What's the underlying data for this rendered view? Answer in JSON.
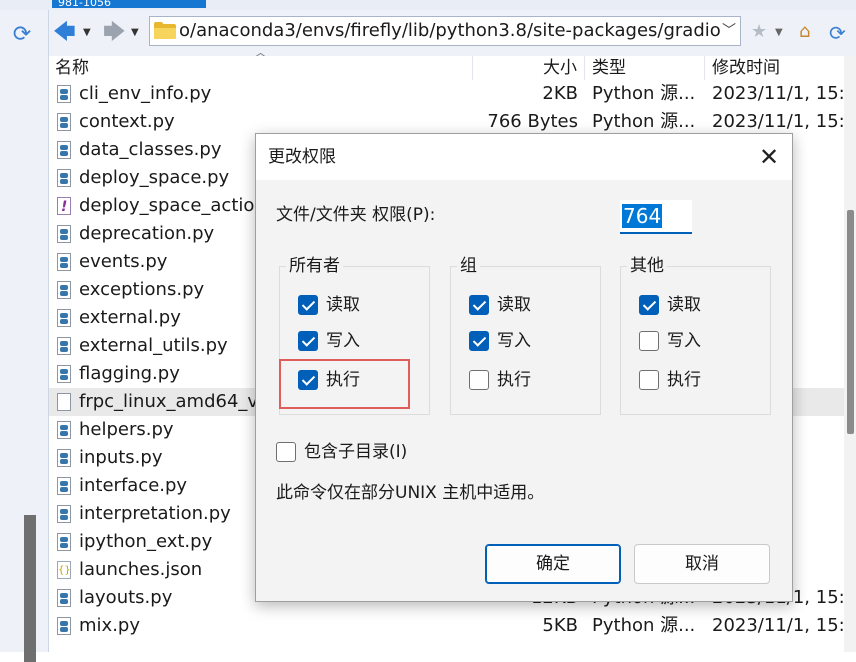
{
  "window": {
    "tab_title": "981-1056"
  },
  "address_bar": {
    "path": "o/anaconda3/envs/firefly/lib/python3.8/site-packages/gradio"
  },
  "columns": {
    "name": "名称",
    "size": "大小",
    "type": "类型",
    "modified": "修改时间"
  },
  "files": [
    {
      "name": "cli_env_info.py",
      "size": "2KB",
      "type": "Python 源...",
      "modified": "2023/11/1, 15:",
      "icon": "python-file-icon"
    },
    {
      "name": "context.py",
      "size": "766 Bytes",
      "type": "Python 源...",
      "modified": "2023/11/1, 15:",
      "icon": "python-file-icon"
    },
    {
      "name": "data_classes.py",
      "size": "",
      "type": "",
      "modified": "1, 15:",
      "icon": "python-file-icon"
    },
    {
      "name": "deploy_space.py",
      "size": "",
      "type": "",
      "modified": "1, 15:",
      "icon": "python-file-icon"
    },
    {
      "name": "deploy_space_action",
      "size": "",
      "type": "",
      "modified": "1, 15:",
      "icon": "unknown-file-icon"
    },
    {
      "name": "deprecation.py",
      "size": "",
      "type": "",
      "modified": "1, 15:",
      "icon": "python-file-icon"
    },
    {
      "name": "events.py",
      "size": "",
      "type": "",
      "modified": "1, 15:",
      "icon": "python-file-icon"
    },
    {
      "name": "exceptions.py",
      "size": "",
      "type": "",
      "modified": "1, 15:",
      "icon": "python-file-icon"
    },
    {
      "name": "external.py",
      "size": "",
      "type": "",
      "modified": "1, 15:",
      "icon": "python-file-icon"
    },
    {
      "name": "external_utils.py",
      "size": "",
      "type": "",
      "modified": "1, 15:",
      "icon": "python-file-icon"
    },
    {
      "name": "flagging.py",
      "size": "",
      "type": "",
      "modified": "1, 15:",
      "icon": "python-file-icon"
    },
    {
      "name": "frpc_linux_amd64_v0",
      "size": "",
      "type": "",
      "modified": "1, 16:",
      "icon": "generic-file-icon"
    },
    {
      "name": "helpers.py",
      "size": "",
      "type": "",
      "modified": "1, 15:",
      "icon": "python-file-icon"
    },
    {
      "name": "inputs.py",
      "size": "",
      "type": "",
      "modified": "1, 15:",
      "icon": "python-file-icon"
    },
    {
      "name": "interface.py",
      "size": "",
      "type": "",
      "modified": "1, 15:",
      "icon": "python-file-icon"
    },
    {
      "name": "interpretation.py",
      "size": "",
      "type": "",
      "modified": "1, 15:",
      "icon": "python-file-icon"
    },
    {
      "name": "ipython_ext.py",
      "size": "",
      "type": "",
      "modified": "1, 15:",
      "icon": "python-file-icon"
    },
    {
      "name": "launches.json",
      "size": "",
      "type": "",
      "modified": "1, 20:",
      "icon": "json-file-icon"
    },
    {
      "name": "layouts.py",
      "size": "12KB",
      "type": "Python 源...",
      "modified": "2023/11/1, 15:",
      "icon": "python-file-icon"
    },
    {
      "name": "mix.py",
      "size": "5KB",
      "type": "Python 源...",
      "modified": "2023/11/1, 15:",
      "icon": "python-file-icon"
    }
  ],
  "selected_file_index": 11,
  "dialog": {
    "title": "更改权限",
    "permission_label": "文件/文件夹 权限(P):",
    "permission_value": "764",
    "groups": [
      {
        "name": "所有者",
        "read": {
          "label": "读取",
          "checked": true
        },
        "write": {
          "label": "写入",
          "checked": true
        },
        "exec": {
          "label": "执行",
          "checked": true
        }
      },
      {
        "name": "组",
        "read": {
          "label": "读取",
          "checked": true
        },
        "write": {
          "label": "写入",
          "checked": true
        },
        "exec": {
          "label": "执行",
          "checked": false
        }
      },
      {
        "name": "其他",
        "read": {
          "label": "读取",
          "checked": true
        },
        "write": {
          "label": "写入",
          "checked": false
        },
        "exec": {
          "label": "执行",
          "checked": false
        }
      }
    ],
    "include_subdirs": {
      "label": "包含子目录(I)",
      "checked": false
    },
    "note": "此命令仅在部分UNIX 主机中适用。",
    "ok_label": "确定",
    "cancel_label": "取消"
  },
  "colors": {
    "accent": "#005fb8",
    "highlight_box": "#e05d5d",
    "folder": "#f7d55c"
  }
}
